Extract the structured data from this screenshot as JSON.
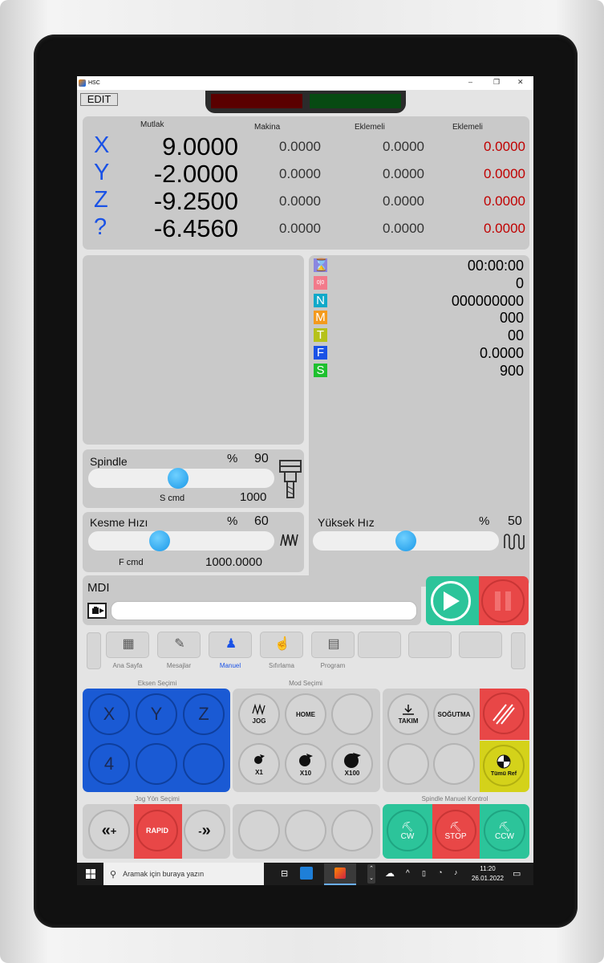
{
  "window": {
    "title": "HSC",
    "minimize": "–",
    "maximize": "❐",
    "close": "✕"
  },
  "toolbar": {
    "edit_label": "EDIT"
  },
  "coords": {
    "headers": {
      "absolute": "Mutlak",
      "machine": "Makina",
      "incremental1": "Eklemeli",
      "incremental2": "Eklemeli"
    },
    "rows": [
      {
        "axis": "X",
        "abs": "9.0000",
        "machine": "0.0000",
        "inc1": "0.0000",
        "inc2": "0.0000"
      },
      {
        "axis": "Y",
        "abs": "-2.0000",
        "machine": "0.0000",
        "inc1": "0.0000",
        "inc2": "0.0000"
      },
      {
        "axis": "Z",
        "abs": "-9.2500",
        "machine": "0.0000",
        "inc1": "0.0000",
        "inc2": "0.0000"
      },
      {
        "axis": "?",
        "abs": "-6.4560",
        "machine": "0.0000",
        "inc1": "0.0000",
        "inc2": "0.0000"
      }
    ]
  },
  "status": [
    {
      "icon": "hourglass-icon",
      "glyph": "⌛",
      "color": "#8a86e0",
      "value": "00:00:00"
    },
    {
      "icon": "counter-icon",
      "glyph": "0|0",
      "color": "#f27a8a",
      "value": "0"
    },
    {
      "icon": "n-icon",
      "glyph": "N",
      "color": "#10a9c9",
      "value": "000000000"
    },
    {
      "icon": "m-icon",
      "glyph": "M",
      "color": "#f49a1c",
      "value": "000"
    },
    {
      "icon": "t-icon",
      "glyph": "T",
      "color": "#b6c21a",
      "value": "00"
    },
    {
      "icon": "f-icon",
      "glyph": "F",
      "color": "#1a52e6",
      "value": "0.0000"
    },
    {
      "icon": "s-icon",
      "glyph": "S",
      "color": "#1ec02e",
      "value": "900"
    }
  ],
  "spindle": {
    "label": "Spindle",
    "percent_sign": "%",
    "percent": "90",
    "cmd_label": "S cmd",
    "cmd_value": "1000",
    "level": 0.48
  },
  "feed": {
    "label": "Kesme Hızı",
    "percent_sign": "%",
    "percent": "60",
    "cmd_label": "F cmd",
    "cmd_value": "1000.0000",
    "level": 0.37
  },
  "rapid": {
    "label": "Yüksek Hız",
    "percent_sign": "%",
    "percent": "50",
    "level": 0.5
  },
  "mdi": {
    "label": "MDI",
    "input_value": ""
  },
  "nav": [
    {
      "label": "Ana Sayfa",
      "icon": "grid-icon"
    },
    {
      "label": "Mesajlar",
      "icon": "message-icon"
    },
    {
      "label": "Manuel",
      "icon": "manual-icon"
    },
    {
      "label": "Sıfırlama",
      "icon": "reset-icon"
    },
    {
      "label": "Program",
      "icon": "program-icon"
    }
  ],
  "sections": {
    "axis_select": "Eksen Seçimi",
    "mode_select": "Mod Seçimi",
    "jog_dir": "Jog Yön Seçimi",
    "spindle_manual": "Spindle Manuel Kontrol"
  },
  "axis_buttons": [
    "X",
    "Y",
    "Z",
    "4",
    "",
    ""
  ],
  "mode_buttons": {
    "jog": "JOG",
    "home": "HOME",
    "x1": "X1",
    "x10": "X10",
    "x100": "X100"
  },
  "aux_buttons": {
    "tool": "TAKIM",
    "coolant": "SOĞUTMA",
    "ref_all": "Tümü Ref"
  },
  "jog_buttons": {
    "plus": "+",
    "rapid": "RAPID",
    "minus": "-"
  },
  "spindle_buttons": {
    "cw": "CW",
    "stop": "STOP",
    "ccw": "CCW"
  },
  "taskbar": {
    "search_placeholder": "Aramak için buraya yazın",
    "time": "11:20",
    "date": "26.01.2022"
  },
  "colors": {
    "axis_blue": "#1a52e6",
    "red_value": "#c00000",
    "teal": "#2cc49a",
    "red": "#e84747",
    "yellow": "#d4d21a",
    "axis_panel": "#1a5ad4"
  }
}
